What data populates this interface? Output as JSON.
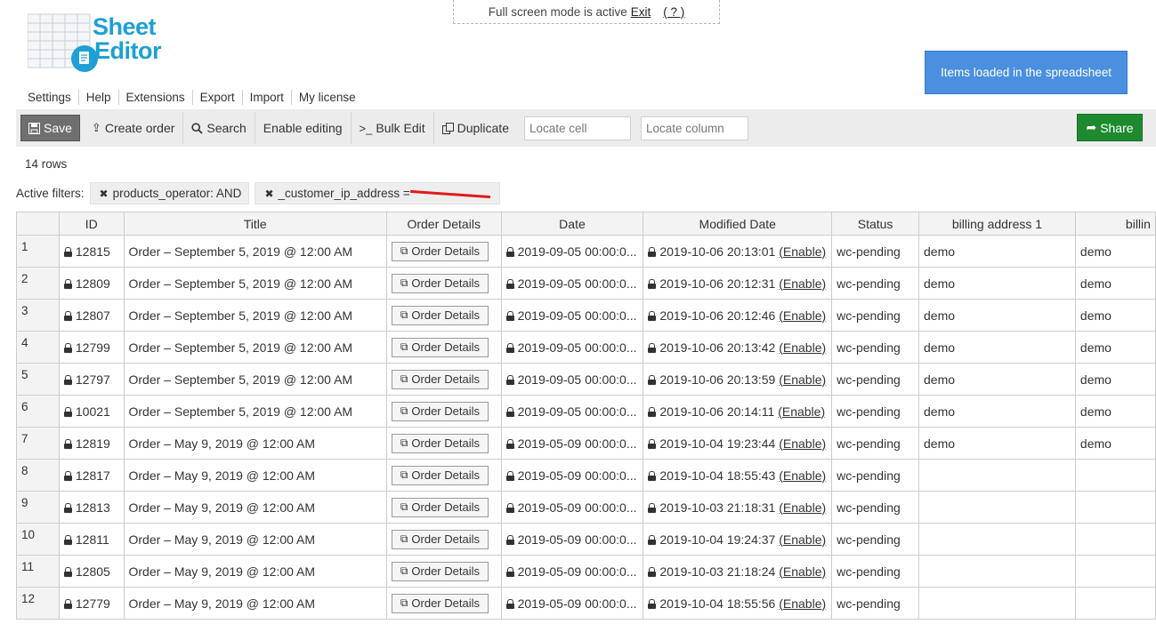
{
  "fullscreen": {
    "text": "Full screen mode is active",
    "exit_label": "Exit",
    "help_label": "( ? )"
  },
  "logo": {
    "line1": "Sheet",
    "line2": "Editor"
  },
  "menu": [
    "Settings",
    "Help",
    "Extensions",
    "Export",
    "Import",
    "My license"
  ],
  "items_loaded_label": "Items loaded in the spreadsheet",
  "toolbar": {
    "save_label": "Save",
    "create_order_label": "Create order",
    "search_label": "Search",
    "enable_editing_label": "Enable editing",
    "bulk_edit_label": "Bulk Edit",
    "duplicate_label": "Duplicate",
    "locate_cell_placeholder": "Locate cell",
    "locate_column_placeholder": "Locate column",
    "share_label": "Share"
  },
  "rows_count": "14 rows",
  "filters": {
    "label": "Active filters:",
    "items": [
      "products_operator: AND",
      "_customer_ip_address ="
    ]
  },
  "columns": [
    "ID",
    "Title",
    "Order Details",
    "Date",
    "Modified Date",
    "Status",
    "billing address 1",
    "billin"
  ],
  "order_details_label": "Order Details",
  "enable_label": "(Enable)",
  "rows": [
    {
      "n": "1",
      "id": "12815",
      "title": "Order – September 5, 2019 @ 12:00 AM",
      "date": "2019-09-05 00:00:0...",
      "modified": "2019-10-06 20:13:01",
      "status": "wc-pending",
      "billing1": "demo",
      "billing2": "demo"
    },
    {
      "n": "2",
      "id": "12809",
      "title": "Order – September 5, 2019 @ 12:00 AM",
      "date": "2019-09-05 00:00:0...",
      "modified": "2019-10-06 20:12:31",
      "status": "wc-pending",
      "billing1": "demo",
      "billing2": "demo"
    },
    {
      "n": "3",
      "id": "12807",
      "title": "Order – September 5, 2019 @ 12:00 AM",
      "date": "2019-09-05 00:00:0...",
      "modified": "2019-10-06 20:12:46",
      "status": "wc-pending",
      "billing1": "demo",
      "billing2": "demo"
    },
    {
      "n": "4",
      "id": "12799",
      "title": "Order – September 5, 2019 @ 12:00 AM",
      "date": "2019-09-05 00:00:0...",
      "modified": "2019-10-06 20:13:42",
      "status": "wc-pending",
      "billing1": "demo",
      "billing2": "demo"
    },
    {
      "n": "5",
      "id": "12797",
      "title": "Order – September 5, 2019 @ 12:00 AM",
      "date": "2019-09-05 00:00:0...",
      "modified": "2019-10-06 20:13:59",
      "status": "wc-pending",
      "billing1": "demo",
      "billing2": "demo"
    },
    {
      "n": "6",
      "id": "10021",
      "title": "Order – September 5, 2019 @ 12:00 AM",
      "date": "2019-09-05 00:00:0...",
      "modified": "2019-10-06 20:14:11",
      "status": "wc-pending",
      "billing1": "demo",
      "billing2": "demo"
    },
    {
      "n": "7",
      "id": "12819",
      "title": "Order – May 9, 2019 @ 12:00 AM",
      "date": "2019-05-09 00:00:0...",
      "modified": "2019-10-04 19:23:44",
      "status": "wc-pending",
      "billing1": "demo",
      "billing2": "demo"
    },
    {
      "n": "8",
      "id": "12817",
      "title": "Order – May 9, 2019 @ 12:00 AM",
      "date": "2019-05-09 00:00:0...",
      "modified": "2019-10-04 18:55:43",
      "status": "wc-pending",
      "billing1": "",
      "billing2": ""
    },
    {
      "n": "9",
      "id": "12813",
      "title": "Order – May 9, 2019 @ 12:00 AM",
      "date": "2019-05-09 00:00:0...",
      "modified": "2019-10-03 21:18:31",
      "status": "wc-pending",
      "billing1": "",
      "billing2": ""
    },
    {
      "n": "10",
      "id": "12811",
      "title": "Order – May 9, 2019 @ 12:00 AM",
      "date": "2019-05-09 00:00:0...",
      "modified": "2019-10-04 19:24:37",
      "status": "wc-pending",
      "billing1": "",
      "billing2": ""
    },
    {
      "n": "11",
      "id": "12805",
      "title": "Order – May 9, 2019 @ 12:00 AM",
      "date": "2019-05-09 00:00:0...",
      "modified": "2019-10-03 21:18:24",
      "status": "wc-pending",
      "billing1": "",
      "billing2": ""
    },
    {
      "n": "12",
      "id": "12779",
      "title": "Order – May 9, 2019 @ 12:00 AM",
      "date": "2019-05-09 00:00:0...",
      "modified": "2019-10-04 18:55:56",
      "status": "wc-pending",
      "billing1": "",
      "billing2": ""
    }
  ],
  "colors": {
    "accent_blue": "#1e9fd5",
    "items_loaded_bg": "#4a8fe0",
    "share_green": "#1e8a2f",
    "save_gray": "#6f6f6f",
    "redaction_red": "#e01b1b"
  }
}
